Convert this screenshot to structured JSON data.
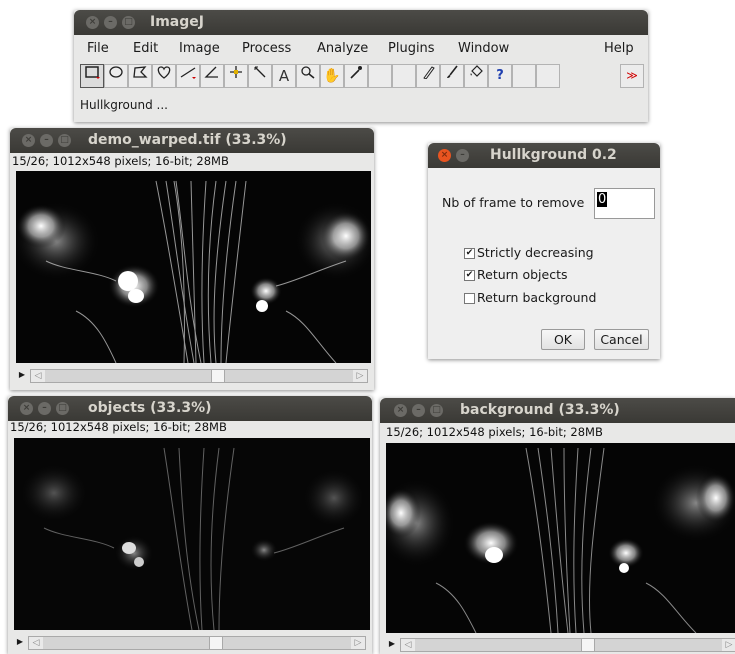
{
  "imagej": {
    "title": "ImageJ",
    "menus": [
      "File",
      "Edit",
      "Image",
      "Process",
      "Analyze",
      "Plugins",
      "Window",
      "Help"
    ],
    "tools": [
      "rectangle-tool",
      "oval-tool",
      "polygon-tool",
      "freehand-tool",
      "line-tool",
      "angle-tool",
      "point-tool",
      "wand-tool",
      "text-tool",
      "magnifier-tool",
      "hand-tool",
      "color-picker-tool",
      "",
      "",
      "pencil-tool",
      "brush-tool",
      "flood-fill-tool",
      "help-tool",
      "",
      "",
      "more-tools"
    ],
    "status": "Hullkground ..."
  },
  "windows": {
    "demo": {
      "title": "demo_warped.tif (33.3%)",
      "info": "15/26; 1012x548 pixels; 16-bit; 28MB"
    },
    "objects": {
      "title": "objects (33.3%)",
      "info": "15/26; 1012x548 pixels; 16-bit; 28MB"
    },
    "background": {
      "title": "background (33.3%)",
      "info": "15/26; 1012x548 pixels; 16-bit; 28MB"
    }
  },
  "dialog": {
    "title": "Hullkground 0.2",
    "field_label": "Nb of frame to remove",
    "field_value": "0",
    "checkboxes": [
      {
        "label": "Strictly decreasing",
        "checked": true
      },
      {
        "label": "Return objects",
        "checked": true
      },
      {
        "label": "Return background",
        "checked": false
      }
    ],
    "ok": "OK",
    "cancel": "Cancel"
  },
  "slider": {
    "frame": 15,
    "frames": 26
  }
}
